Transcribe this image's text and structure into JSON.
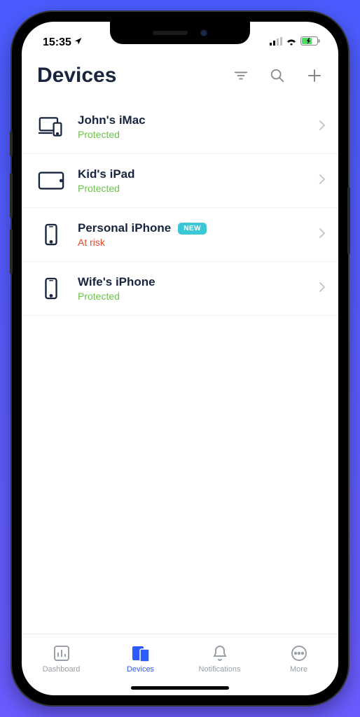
{
  "status_bar": {
    "time": "15:35"
  },
  "header": {
    "title": "Devices"
  },
  "devices": [
    {
      "icon": "imac",
      "name": "John's iMac",
      "status": "Protected",
      "status_kind": "protected",
      "badge": null
    },
    {
      "icon": "ipad",
      "name": "Kid's iPad",
      "status": "Protected",
      "status_kind": "protected",
      "badge": null
    },
    {
      "icon": "iphone",
      "name": "Personal iPhone",
      "status": "At risk",
      "status_kind": "risk",
      "badge": "NEW"
    },
    {
      "icon": "iphone",
      "name": "Wife's iPhone",
      "status": "Protected",
      "status_kind": "protected",
      "badge": null
    }
  ],
  "tabs": [
    {
      "id": "dashboard",
      "label": "Dashboard",
      "active": false
    },
    {
      "id": "devices",
      "label": "Devices",
      "active": true
    },
    {
      "id": "notifications",
      "label": "Notifications",
      "active": false
    },
    {
      "id": "more",
      "label": "More",
      "active": false
    }
  ]
}
